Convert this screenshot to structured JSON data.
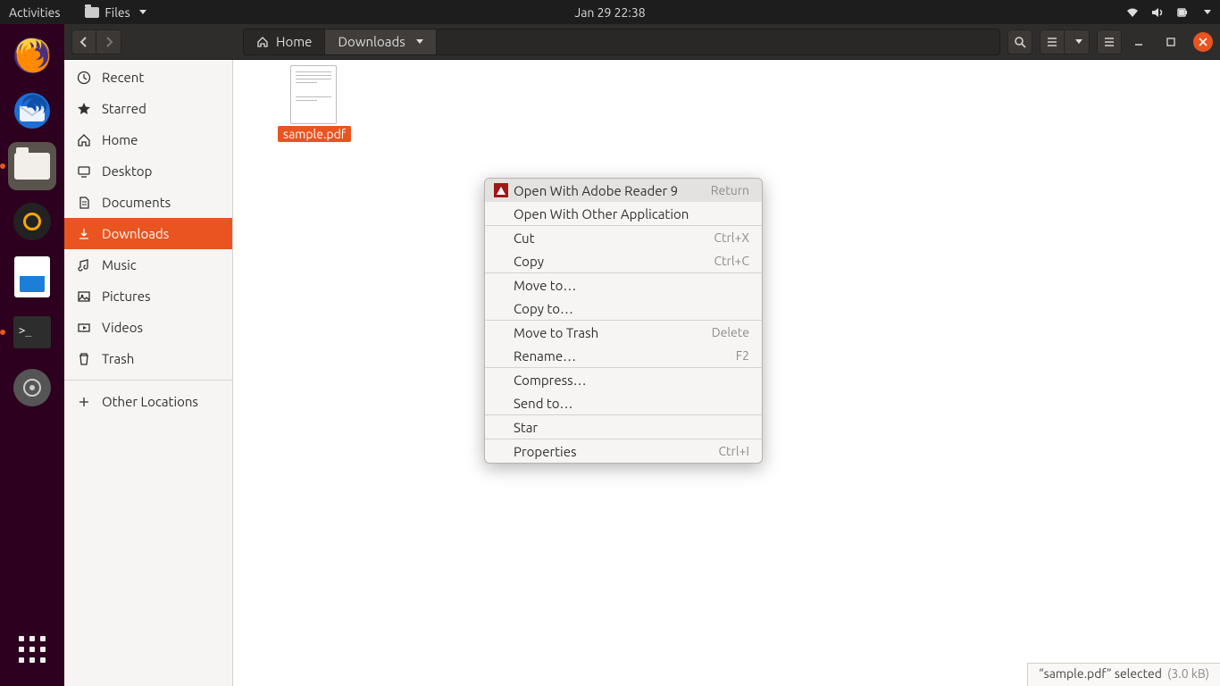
{
  "topbar": {
    "activities": "Activities",
    "app_menu": "Files",
    "clock": "Jan 29  22:38"
  },
  "dock": [
    {
      "name": "firefox"
    },
    {
      "name": "thunderbird"
    },
    {
      "name": "files",
      "running": true
    },
    {
      "name": "rhythmbox"
    },
    {
      "name": "libreoffice-writer"
    },
    {
      "name": "terminal",
      "running": true
    },
    {
      "name": "usb-creator"
    }
  ],
  "breadcrumb": {
    "home": "Home",
    "current": "Downloads"
  },
  "sidebar": [
    {
      "icon": "clock",
      "label": "Recent"
    },
    {
      "icon": "star",
      "label": "Starred"
    },
    {
      "icon": "home",
      "label": "Home"
    },
    {
      "icon": "desktop",
      "label": "Desktop"
    },
    {
      "icon": "documents",
      "label": "Documents"
    },
    {
      "icon": "downloads",
      "label": "Downloads",
      "active": true
    },
    {
      "icon": "music",
      "label": "Music"
    },
    {
      "icon": "pictures",
      "label": "Pictures"
    },
    {
      "icon": "videos",
      "label": "Videos"
    },
    {
      "icon": "trash",
      "label": "Trash"
    }
  ],
  "sidebar_other": "Other Locations",
  "file": {
    "name": "sample.pdf"
  },
  "context_menu": [
    {
      "label": "Open With Adobe Reader 9",
      "shortcut": "Return",
      "icon": "adobe",
      "highlight": true
    },
    {
      "label": "Open With Other Application"
    },
    {
      "sep": true
    },
    {
      "label": "Cut",
      "shortcut": "Ctrl+X"
    },
    {
      "label": "Copy",
      "shortcut": "Ctrl+C"
    },
    {
      "sep": true
    },
    {
      "label": "Move to…"
    },
    {
      "label": "Copy to…"
    },
    {
      "sep": true
    },
    {
      "label": "Move to Trash",
      "shortcut": "Delete"
    },
    {
      "label": "Rename…",
      "shortcut": "F2"
    },
    {
      "sep": true
    },
    {
      "label": "Compress…"
    },
    {
      "label": "Send to…"
    },
    {
      "sep": true
    },
    {
      "label": "Star"
    },
    {
      "sep": true
    },
    {
      "label": "Properties",
      "shortcut": "Ctrl+I"
    }
  ],
  "statusbar": {
    "text": "“sample.pdf” selected",
    "size": "(3.0 kB)"
  }
}
